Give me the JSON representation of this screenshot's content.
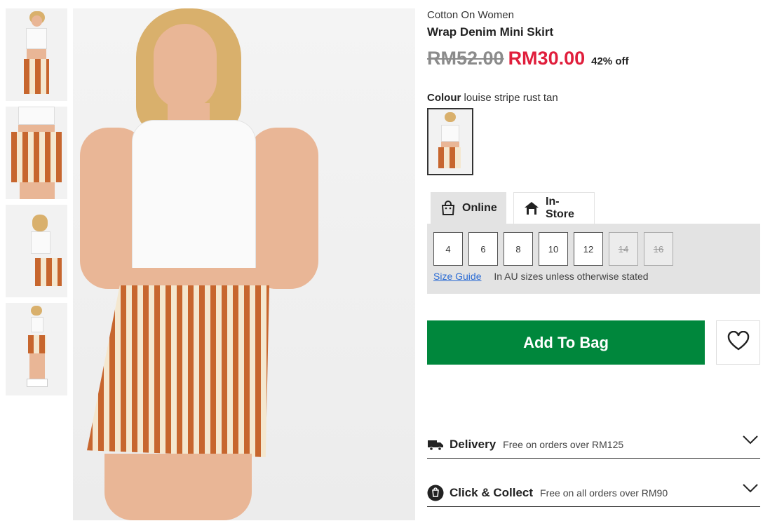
{
  "product": {
    "brand": "Cotton On Women",
    "name": "Wrap Denim Mini Skirt",
    "old_price": "RM52.00",
    "new_price": "RM30.00",
    "discount": "42% off",
    "colour_label": "Colour",
    "colour_value": "louise stripe rust tan"
  },
  "tabs": {
    "online": "Online",
    "instore": "In-Store"
  },
  "sizes": [
    {
      "label": "4",
      "available": true
    },
    {
      "label": "6",
      "available": true
    },
    {
      "label": "8",
      "available": true
    },
    {
      "label": "10",
      "available": true
    },
    {
      "label": "12",
      "available": true
    },
    {
      "label": "14",
      "available": false
    },
    {
      "label": "16",
      "available": false
    }
  ],
  "size_guide": {
    "link": "Size Guide",
    "note": "In AU sizes unless otherwise stated"
  },
  "actions": {
    "add_to_bag": "Add To Bag"
  },
  "delivery": {
    "title": "Delivery",
    "subtitle": "Free on orders over RM125"
  },
  "collect": {
    "title": "Click & Collect",
    "subtitle": "Free on all orders over RM90"
  },
  "colors": {
    "brand_green": "#00873c",
    "sale_red": "#e01e3c"
  }
}
